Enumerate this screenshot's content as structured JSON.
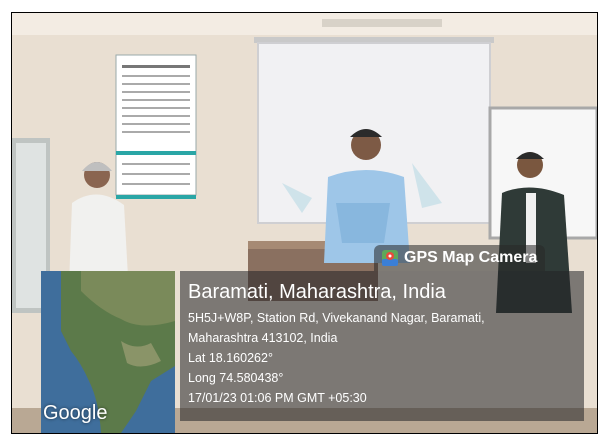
{
  "overlay": {
    "badge_label": "GPS Map Camera",
    "location_title": "Baramati, Maharashtra, India",
    "address_line1": "5H5J+W8P, Station Rd, Vivekanand Nagar, Baramati,",
    "address_line2": "Maharashtra 413102, India",
    "latitude": "Lat 18.160262°",
    "longitude": "Long 74.580438°",
    "timestamp": "17/01/23 01:06 PM GMT +05:30"
  },
  "map": {
    "logo_text": "Google"
  },
  "colors": {
    "panel_bg": "#232326",
    "text": "#ffffff",
    "wall": "#e8ddd0"
  },
  "icons": {
    "badge_icon": "map-pin-icon"
  }
}
